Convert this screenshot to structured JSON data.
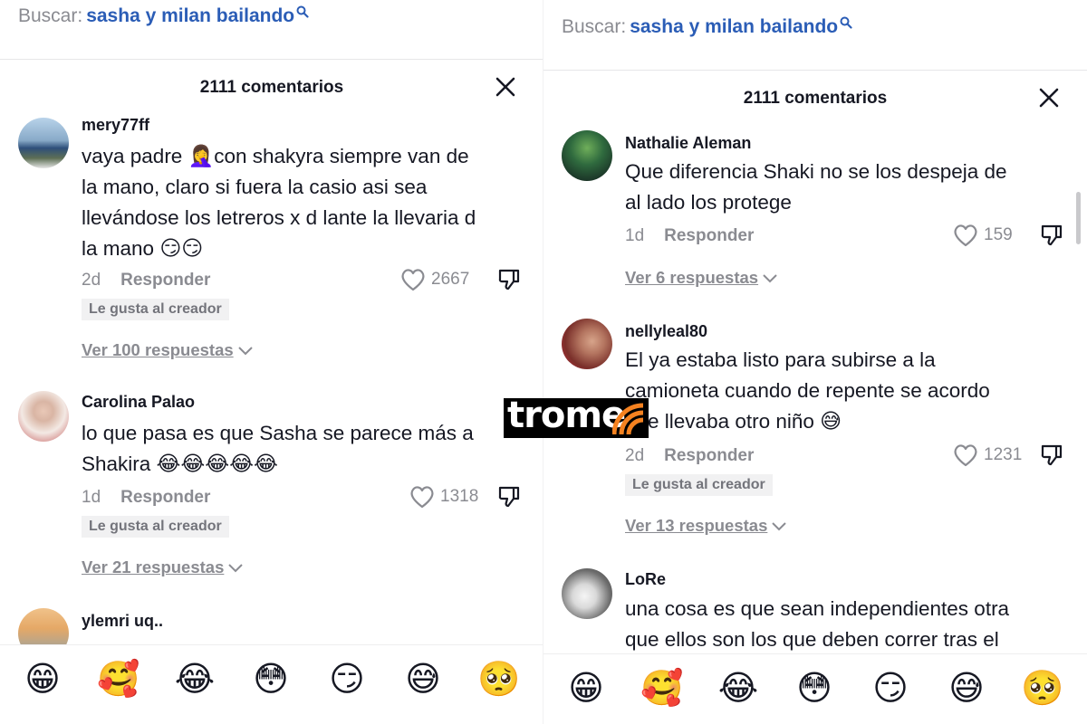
{
  "left": {
    "search": {
      "label": "Buscar:",
      "query": "sasha y milan bailando"
    },
    "comments_count": "2111 comentarios",
    "comments": [
      {
        "username": "mery77ff",
        "lines": [
          "vaya padre ",
          "con shakyra siempre van de",
          "la mano, claro si fuera la casio asi sea",
          "llevándose los letreros x d lante la llevaria d",
          "la mano "
        ],
        "emojis_inline": [
          "🤦‍♀️",
          "😏😏"
        ],
        "time": "2d",
        "reply": "Responder",
        "likes": "2667",
        "creator_badge": "Le gusta al creador",
        "replies": "Ver 100 respuestas"
      },
      {
        "username": "Carolina Palao",
        "lines": [
          "lo que pasa es que Sasha se parece más a",
          "Shakira "
        ],
        "emojis_inline": [
          "😂😂😂😂😂"
        ],
        "time": "1d",
        "reply": "Responder",
        "likes": "1318",
        "creator_badge": "Le gusta al creador",
        "replies": "Ver 21 respuestas"
      },
      {
        "username": "ylemri uq.."
      }
    ],
    "emoji_bar": [
      "😁",
      "🥰",
      "😂",
      "😳",
      "😏",
      "😅",
      "🥺"
    ]
  },
  "right": {
    "search": {
      "label": "Buscar:",
      "query": "sasha y milan bailando"
    },
    "comments_count": "2111 comentarios",
    "comments": [
      {
        "username": "Nathalie Aleman",
        "lines": [
          "Que diferencia Shaki no se los despeja de",
          "al lado los protege"
        ],
        "time": "1d",
        "reply": "Responder",
        "likes": "159",
        "replies": "Ver 6 respuestas"
      },
      {
        "username": "nellyleal80",
        "lines": [
          "El ya estaba listo para subirse a la",
          "camioneta cuando de repente se acordo",
          "que llevaba otro niño "
        ],
        "emojis_inline": [
          "😅"
        ],
        "time": "2d",
        "reply": "Responder",
        "likes": "1231",
        "creator_badge": "Le gusta al creador",
        "replies": "Ver 13 respuestas"
      },
      {
        "username": "LoRe",
        "lines": [
          "una cosa es que sean independientes otra",
          "que ellos son los que deben correr tras el"
        ]
      }
    ],
    "emoji_bar": [
      "😁",
      "🥰",
      "😂",
      "😳",
      "😏",
      "😅",
      "🥺"
    ]
  },
  "watermark": {
    "text": "trome"
  },
  "icons": {
    "search": "search-icon",
    "close": "close-icon",
    "heart": "heart-icon",
    "dislike": "dislike-icon",
    "chevron": "chevron-down-icon"
  },
  "colors": {
    "link": "#2b5db6",
    "muted": "#8a8b91",
    "text": "#161823",
    "badge_bg": "#f1f1f2",
    "logo_orange": "#f58220"
  }
}
